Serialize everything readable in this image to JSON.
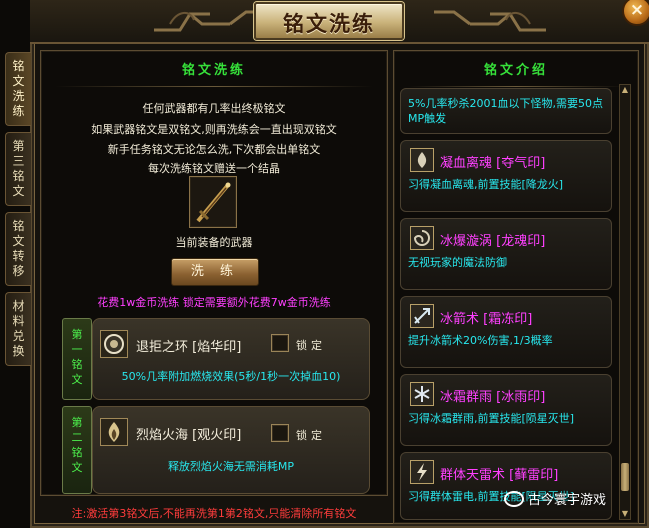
{
  "window": {
    "title": "铭文洗练",
    "close_icon": "×"
  },
  "side_tabs": [
    {
      "label": "铭文洗练",
      "active": true
    },
    {
      "label": "第三铭文",
      "active": false
    },
    {
      "label": "铭文转移",
      "active": false
    },
    {
      "label": "材料兑换",
      "active": false
    }
  ],
  "left_panel": {
    "heading": "铭文洗练",
    "info_lines": [
      "任何武器都有几率出终极铭文",
      "如果武器铭文是双铭文,则再洗练会一直出现双铭文",
      "新手任务铭文无论怎么洗,下次都会出单铭文",
      "每次洗练铭文赠送一个结晶"
    ],
    "weapon_icon": "sword-icon",
    "weapon_caption": "当前装备的武器",
    "wash_button": "洗 练",
    "cost_text": "花费1w金币洗练  锁定需要额外花费7w金币洗练",
    "slots": [
      {
        "label": "第一铭文",
        "name": "退拒之环  [焰华印]",
        "lock_label": "锁定",
        "effect": "50%几率附加燃烧效果(5秒/1秒一次掉血10)"
      },
      {
        "label": "第二铭文",
        "name": "烈焰火海  [观火印]",
        "lock_label": "锁定",
        "effect": "释放烈焰火海无需消耗MP"
      }
    ],
    "warning": "注:激活第3铭文后,不能再洗第1第2铭文,只能清除所有铭文"
  },
  "right_panel": {
    "heading": "铭文介绍",
    "partial_desc": "5%几率秒杀2001血以下怪物,需要50点MP触发",
    "items": [
      {
        "name": "凝血离魂  [夺气印]",
        "desc": "习得凝血离魂,前置技能[降龙火]"
      },
      {
        "name": "冰爆漩涡  [龙魂印]",
        "desc": "无视玩家的魔法防御"
      },
      {
        "name": "冰箭术  [霜冻印]",
        "desc": "提升冰箭术20%伤害,1/3概率"
      },
      {
        "name": "冰霜群雨  [冰雨印]",
        "desc": "习得冰霜群雨,前置技能[陨星灭世]"
      },
      {
        "name": "群体天雷术  [藓雷印]",
        "desc": "习得群体雷电,前置技能[陨星灭世]"
      }
    ]
  },
  "watermark": "古今寰宇游戏",
  "colors": {
    "heading_green": "#36e03a",
    "effect_cyan": "#28e8ee",
    "cost_magenta": "#ff40ff",
    "warning_red": "#ff3c3c"
  }
}
